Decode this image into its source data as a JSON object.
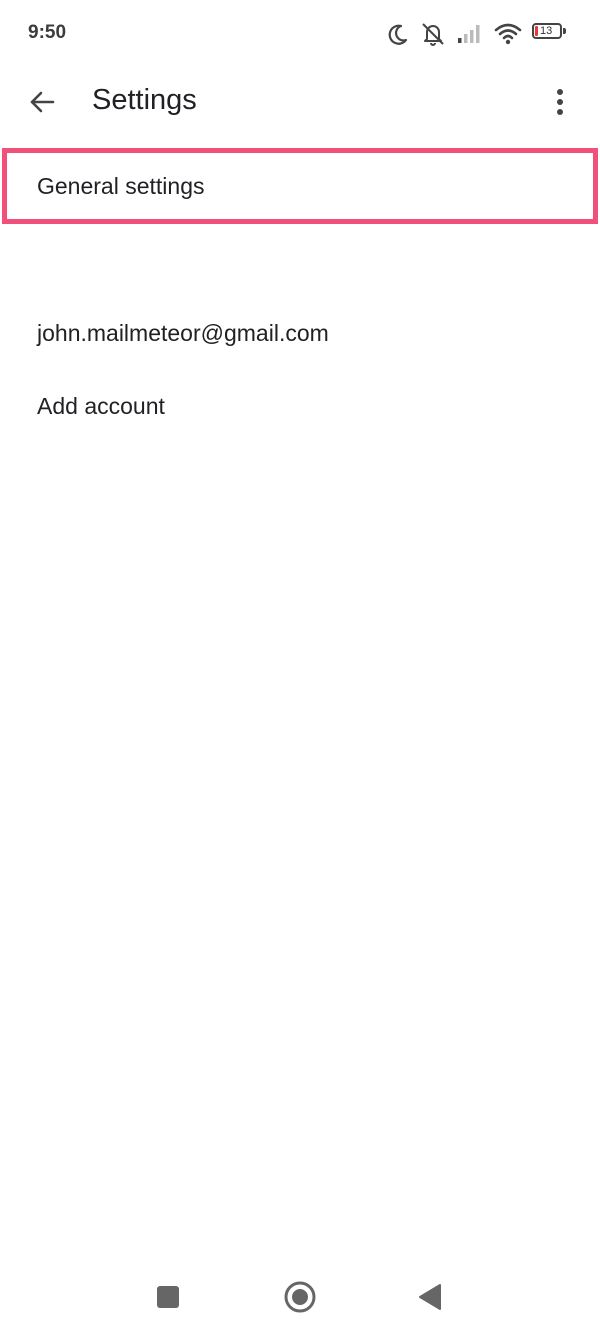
{
  "status_bar": {
    "time": "9:50",
    "icons": [
      "moon-icon",
      "bell-off-icon",
      "signal-icon",
      "wifi-icon",
      "battery-icon"
    ],
    "battery_level": "13",
    "battery_color": "#e53935"
  },
  "app_bar": {
    "title": "Settings",
    "back_icon": "arrow-back-icon",
    "menu_icon": "more-vert-icon"
  },
  "list": {
    "items": [
      {
        "label": "General settings",
        "highlighted": true
      },
      {
        "label": "john.mailmeteor@gmail.com"
      },
      {
        "label": "Add account"
      }
    ]
  },
  "highlight_color": "#f0507a",
  "nav_bar": {
    "icons": [
      "recents-square-icon",
      "home-circle-icon",
      "back-triangle-icon"
    ]
  }
}
